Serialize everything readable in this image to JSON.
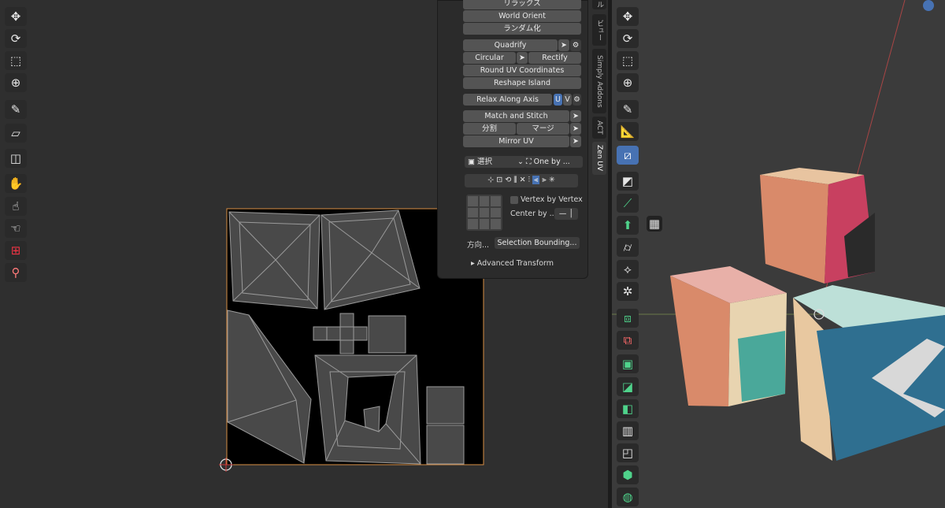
{
  "panel": {
    "relax_label": "リラックス",
    "world_orient": "World Orient",
    "randomize": "ランダム化",
    "quadrify": "Quadrify",
    "circular": "Circular",
    "rectify": "Rectify",
    "round_uv": "Round UV Coordinates",
    "reshape_island": "Reshape Island",
    "relax_along_axis": "Relax Along Axis",
    "axis_u": "U",
    "axis_v": "V",
    "match_stitch": "Match and Stitch",
    "split": "分割",
    "merge": "マージ",
    "mirror_uv": "Mirror UV",
    "select_mode": "選択",
    "one_by": "One by ...",
    "vertex_by_vertex": "Vertex by Vertex",
    "center_by": "Center by ...",
    "direction_label": "方向...",
    "selection_bounding": "Selection Bounding...",
    "advanced_transform": "Advanced Transform"
  },
  "side_icons": {
    "u_icon": "U",
    "td_icon": "TD",
    "help_icon": "?"
  },
  "tabs": [
    "ル",
    "ビュー",
    "Simply Addons",
    "ACT",
    "Zen UV"
  ],
  "colors": {
    "accent": "#4772b3",
    "uv_bg": "#000000",
    "island": "#4a4a4a",
    "border_orange": "#d98f45"
  }
}
